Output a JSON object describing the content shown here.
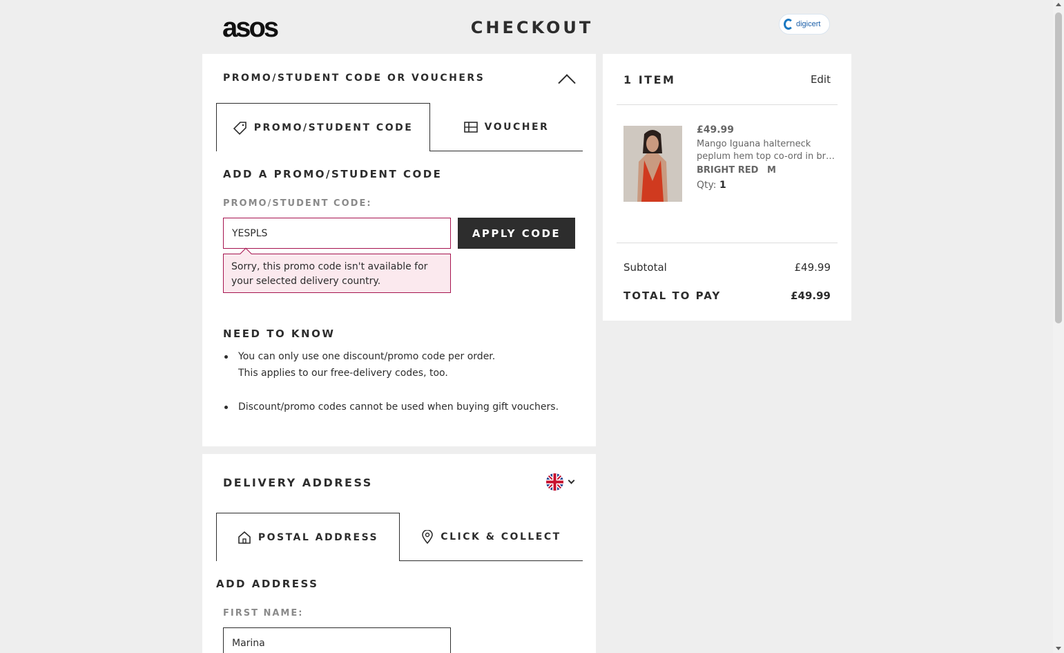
{
  "header": {
    "logo": "asos",
    "title": "CHECKOUT",
    "seal_text": "digicert"
  },
  "promo": {
    "heading": "PROMO/STUDENT CODE OR VOUCHERS",
    "tabs": [
      {
        "label": "PROMO/STUDENT CODE",
        "icon": "tag-icon",
        "active": true
      },
      {
        "label": "VOUCHER",
        "icon": "voucher-icon",
        "active": false
      }
    ],
    "subheading": "ADD A PROMO/STUDENT CODE",
    "field_label": "PROMO/STUDENT CODE:",
    "field_value": "YESPLS",
    "apply_label": "APPLY CODE",
    "error": "Sorry, this promo code isn't available for your selected delivery country.",
    "need_to_know_heading": "NEED TO KNOW",
    "need_to_know": [
      {
        "line1": "You can only use one discount/promo code per order.",
        "line2": "This applies to our free-delivery codes, too."
      },
      {
        "line1": "Discount/promo codes cannot be used when buying gift vouchers.",
        "line2": ""
      }
    ]
  },
  "summary": {
    "heading": "1 ITEM",
    "edit_label": "Edit",
    "item": {
      "price": "£49.99",
      "name_line1": "Mango Iguana halterneck",
      "name_line2": "peplum hem top co-ord in brig...",
      "color": "BRIGHT RED",
      "size": "M",
      "qty_label": "Qty:",
      "qty": "1"
    },
    "subtotal_label": "Subtotal",
    "subtotal_value": "£49.99",
    "total_label": "TOTAL TO PAY",
    "total_value": "£49.99"
  },
  "delivery": {
    "heading": "DELIVERY ADDRESS",
    "country_flag": "uk-flag-icon",
    "tabs": [
      {
        "label": "POSTAL ADDRESS",
        "icon": "home-icon",
        "active": true
      },
      {
        "label": "CLICK & COLLECT",
        "icon": "location-pin-icon",
        "active": false
      }
    ],
    "subheading": "ADD ADDRESS",
    "first_name_label": "FIRST NAME:",
    "first_name_value": "Marina"
  },
  "colors": {
    "accent_dark": "#2d2d2d",
    "error_border": "#a6134f",
    "error_bg": "#fbe9ee",
    "page_bg": "#eeeeee"
  }
}
